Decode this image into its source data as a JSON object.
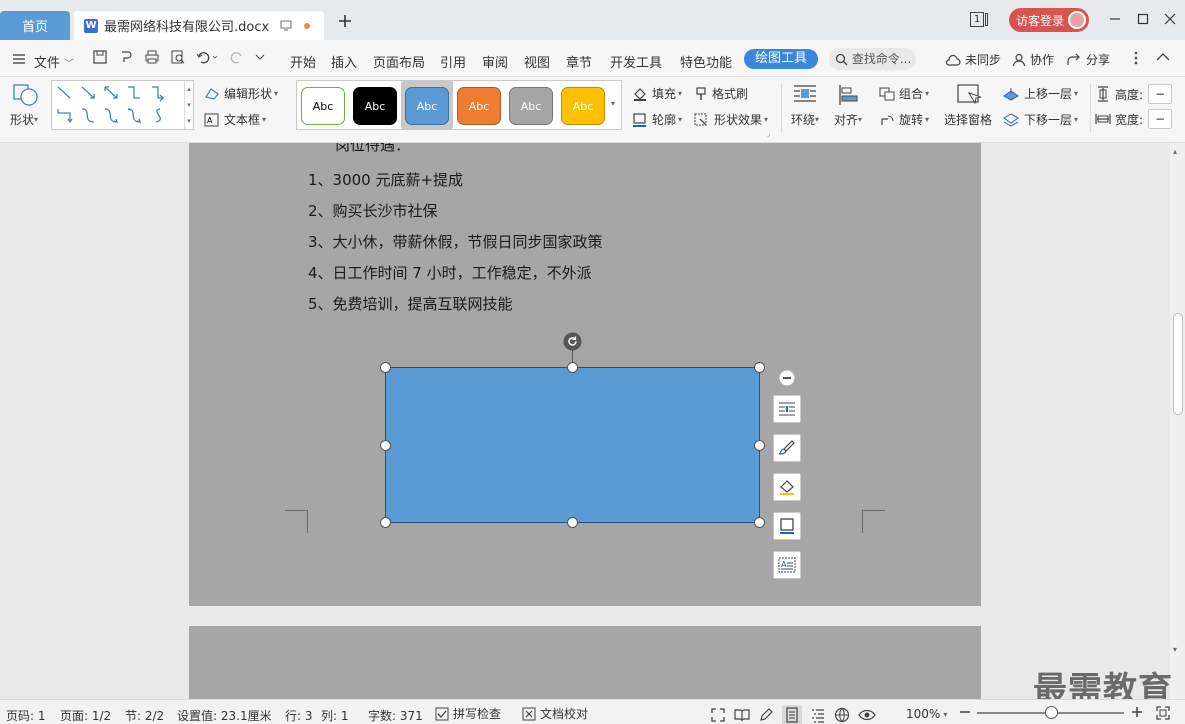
{
  "titlebar": {
    "home_tab": "首页",
    "doc_tab": "最需网络科技有限公司.docx",
    "page_indicator": "1",
    "login_label": "访客登录"
  },
  "menubar": {
    "file_label": "文件",
    "items": [
      "开始",
      "插入",
      "页面布局",
      "引用",
      "审阅",
      "视图",
      "章节",
      "开发工具",
      "特色功能"
    ],
    "active_tab": "绘图工具",
    "search_label": "查找命令...",
    "sync_label": "未同步",
    "collab_label": "协作",
    "share_label": "分享"
  },
  "ribbon": {
    "shape_label": "形状",
    "edit_shape_label": "编辑形状",
    "textbox_label": "文本框",
    "style_swatches": [
      {
        "label": "Abc",
        "bg": "#ffffff",
        "fg": "#000000",
        "border": "#70ad47"
      },
      {
        "label": "Abc",
        "bg": "#000000",
        "fg": "#ffffff",
        "border": "#000000"
      },
      {
        "label": "Abc",
        "bg": "#5b9bd5",
        "fg": "#ffffff",
        "border": "#41719c"
      },
      {
        "label": "Abc",
        "bg": "#ed7d31",
        "fg": "#ffffff",
        "border": "#ae5a21"
      },
      {
        "label": "Abc",
        "bg": "#a5a5a5",
        "fg": "#ffffff",
        "border": "#787878"
      },
      {
        "label": "Abc",
        "bg": "#ffc000",
        "fg": "#ffffff",
        "border": "#bc8c00"
      }
    ],
    "fill_label": "填充",
    "format_painter_label": "格式刷",
    "outline_label": "轮廓",
    "shape_effect_label": "形状效果",
    "wrap_label": "环绕",
    "align_label": "对齐",
    "group_label": "组合",
    "rotate_label": "旋转",
    "selection_pane_label": "选择窗格",
    "bring_forward_label": "上移一层",
    "send_backward_label": "下移一层",
    "height_label": "高度:",
    "width_label": "宽度:"
  },
  "document": {
    "heading_partial": "岗位待遇：",
    "lines": [
      "1、3000 元底薪+提成",
      "2、购买长沙市社保",
      "3、大小休，带薪休假，节假日同步国家政策",
      "4、日工作时间 7 小时，工作稳定，不外派",
      "5、免费培训，提高互联网技能"
    ],
    "shape_fill": "#5b9bd5",
    "shape_stroke": "#2f4f7a"
  },
  "statusbar": {
    "page_code": "页码: 1",
    "page": "页面: 1/2",
    "section": "节: 2/2",
    "setting": "设置值: 23.1厘米",
    "row": "行: 3",
    "col": "列: 1",
    "word_count": "字数: 371",
    "spell_check": "拼写检查",
    "doc_proof": "文档校对",
    "zoom": "100%"
  },
  "watermark": "最需教育"
}
